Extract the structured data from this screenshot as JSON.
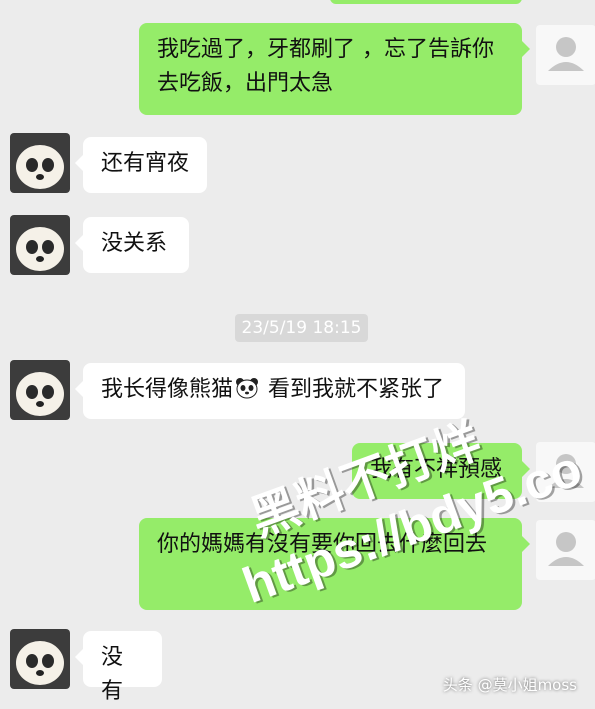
{
  "messages": [
    {
      "side": "right",
      "text": "我吃過了，牙都刷了 ，忘了告訴你去吃飯，出門太急"
    },
    {
      "side": "left",
      "text": "还有宵夜"
    },
    {
      "side": "left",
      "text": "没关系"
    },
    {
      "side": "left",
      "text_before": "我长得像熊猫",
      "emoji": "panda-face",
      "text_after": " 看到我就不紧张了"
    },
    {
      "side": "right",
      "text": "我有不祥預感"
    },
    {
      "side": "right",
      "text": "你的媽媽有沒有要你回去什麼回去"
    },
    {
      "side": "left",
      "text": "没有"
    }
  ],
  "timestamp": "23/5/19 18:15",
  "watermark": {
    "line1": "黑料不打烊",
    "line2": "https://bdy5.co"
  },
  "credit": "头条 @莫小姐moss",
  "colors": {
    "background": "#ececec",
    "bubble_left": "#ffffff",
    "bubble_right": "#95ec69"
  }
}
